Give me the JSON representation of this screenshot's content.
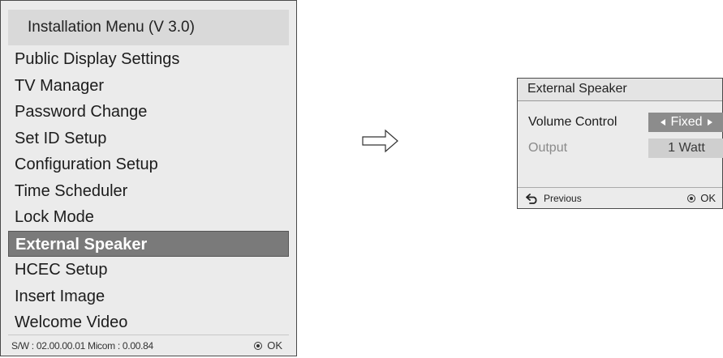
{
  "installation_menu": {
    "title": "Installation Menu (V 3.0)",
    "items": [
      {
        "label": "Public Display Settings",
        "selected": false
      },
      {
        "label": "TV Manager",
        "selected": false
      },
      {
        "label": "Password Change",
        "selected": false
      },
      {
        "label": "Set ID Setup",
        "selected": false
      },
      {
        "label": "Configuration Setup",
        "selected": false
      },
      {
        "label": "Time Scheduler",
        "selected": false
      },
      {
        "label": "Lock Mode",
        "selected": false
      },
      {
        "label": "External Speaker",
        "selected": true
      },
      {
        "label": "HCEC Setup",
        "selected": false
      },
      {
        "label": "Insert Image",
        "selected": false
      },
      {
        "label": "Welcome Video",
        "selected": false
      }
    ],
    "footer": {
      "version_info": "S/W : 02.00.00.01 Micom : 0.00.84",
      "ok_label": "OK",
      "ok_icon": "enter-button-icon"
    }
  },
  "arrow_icon": "right-arrow-icon",
  "external_speaker_dialog": {
    "title": "External Speaker",
    "volume_control": {
      "label": "Volume Control",
      "value": "Fixed"
    },
    "output": {
      "label": "Output",
      "value": "1 Watt"
    },
    "footer": {
      "previous_label": "Previous",
      "previous_icon": "return-arrow-icon",
      "ok_label": "OK",
      "ok_icon": "enter-button-icon"
    }
  },
  "colors": {
    "panel_bg": "#ebebeb",
    "header_bg": "#d9d9d9",
    "selected_bg": "#7a7a7a",
    "active_value_bg": "#8c8c8c",
    "inactive_value_bg": "#cfcfcf",
    "disabled_text": "#8a8a8a"
  }
}
